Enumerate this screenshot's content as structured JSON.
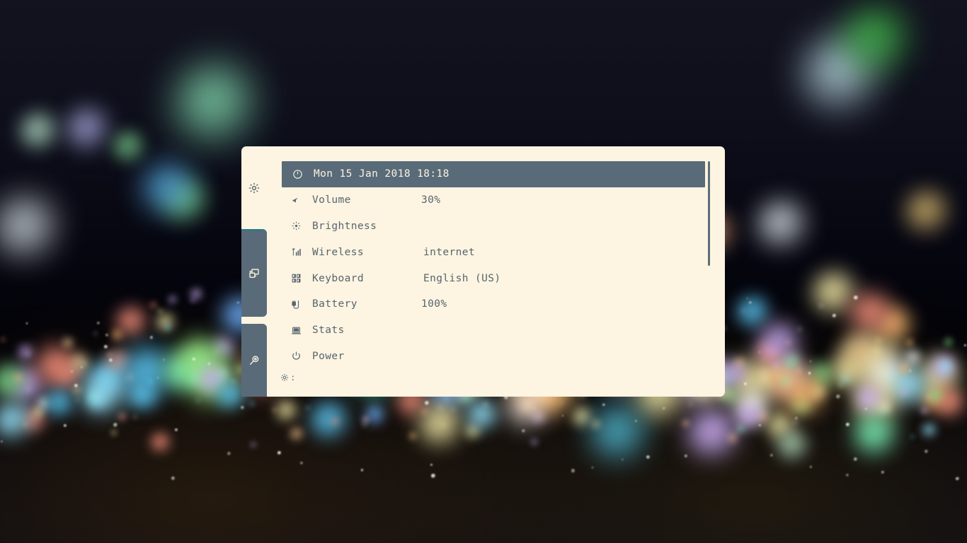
{
  "desktop": {
    "wallpaper_name": "bokeh-lights-wallpaper",
    "background_color": "#06070f"
  },
  "colors": {
    "panel_bg": "#fdf4e1",
    "accent_slate": "#596b78",
    "text": "#56656f",
    "selected_text": "#fbf3e2",
    "rail_accent": "#1d7f85"
  },
  "rail": {
    "top_icon": {
      "name": "gear-icon",
      "glyph": "gear"
    },
    "blocks": [
      {
        "name": "windows-icon",
        "glyph": "windows"
      },
      {
        "name": "search-icon",
        "glyph": "magnifier"
      }
    ]
  },
  "menu": {
    "selected_index": 0,
    "items": [
      {
        "icon": "clock-icon",
        "label": "Mon 15 Jan 2018  18:18",
        "value": "",
        "selected": true,
        "label_is_datetime": true
      },
      {
        "icon": "volume-mute-icon",
        "label": "Volume",
        "value": "30%",
        "selected": false,
        "value_kind": "pct"
      },
      {
        "icon": "brightness-icon",
        "label": "Brightness",
        "value": "",
        "selected": false
      },
      {
        "icon": "wireless-icon",
        "label": "Wireless",
        "value": "internet",
        "selected": false
      },
      {
        "icon": "keyboard-icon",
        "label": "Keyboard",
        "value": "English (US)",
        "selected": false
      },
      {
        "icon": "battery-icon",
        "label": "Battery",
        "value": "100%",
        "selected": false,
        "value_kind": "pct"
      },
      {
        "icon": "stats-icon",
        "label": "Stats",
        "value": "",
        "selected": false
      },
      {
        "icon": "power-icon",
        "label": "Power",
        "value": "",
        "selected": false
      }
    ]
  },
  "prompt": {
    "icon": "gear-icon",
    "text": ":",
    "value": ""
  },
  "scrollbar": {
    "name": "vertical-scrollbar",
    "position": "top"
  }
}
